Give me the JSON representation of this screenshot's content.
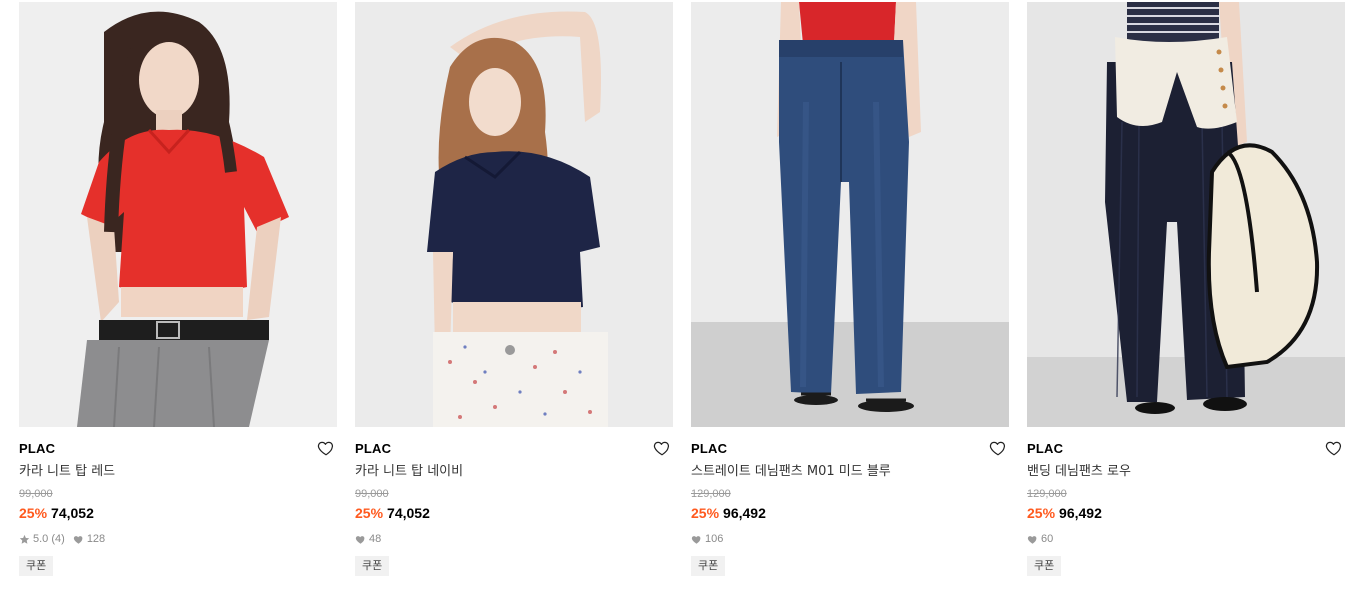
{
  "products": [
    {
      "brand": "PLAC",
      "name": "카라 니트 탑 레드",
      "original_price": "99,000",
      "discount": "25%",
      "price": "74,052",
      "rating": "5.0",
      "reviews": "(4)",
      "likes": "128",
      "badge": "쿠폰",
      "colors": {
        "top": "#e5302b",
        "bottom": "#8d8d8f",
        "bg": "#ececec"
      },
      "image_icon": "model-red-knit-top"
    },
    {
      "brand": "PLAC",
      "name": "카라 니트 탑 네이비",
      "original_price": "99,000",
      "discount": "25%",
      "price": "74,052",
      "likes": "48",
      "badge": "쿠폰",
      "colors": {
        "top": "#1e2546",
        "bottom": "#f4f2ee",
        "bg": "#ebebeb"
      },
      "image_icon": "model-navy-knit-top"
    },
    {
      "brand": "PLAC",
      "name": "스트레이트 데님팬츠 M01 미드 블루",
      "original_price": "129,000",
      "discount": "25%",
      "price": "96,492",
      "likes": "106",
      "badge": "쿠폰",
      "colors": {
        "top": "#d8262a",
        "bottom": "#2f4d7c",
        "bg": "#e8e8e8"
      },
      "image_icon": "model-mid-blue-denim"
    },
    {
      "brand": "PLAC",
      "name": "밴딩 데님팬츠 로우",
      "original_price": "129,000",
      "discount": "25%",
      "price": "96,492",
      "likes": "60",
      "badge": "쿠폰",
      "colors": {
        "top": "#2b2f45",
        "bottom": "#1c2033",
        "bg": "#e6e6e6"
      },
      "image_icon": "model-raw-denim-wide"
    }
  ],
  "accent": "#ff5a1f"
}
